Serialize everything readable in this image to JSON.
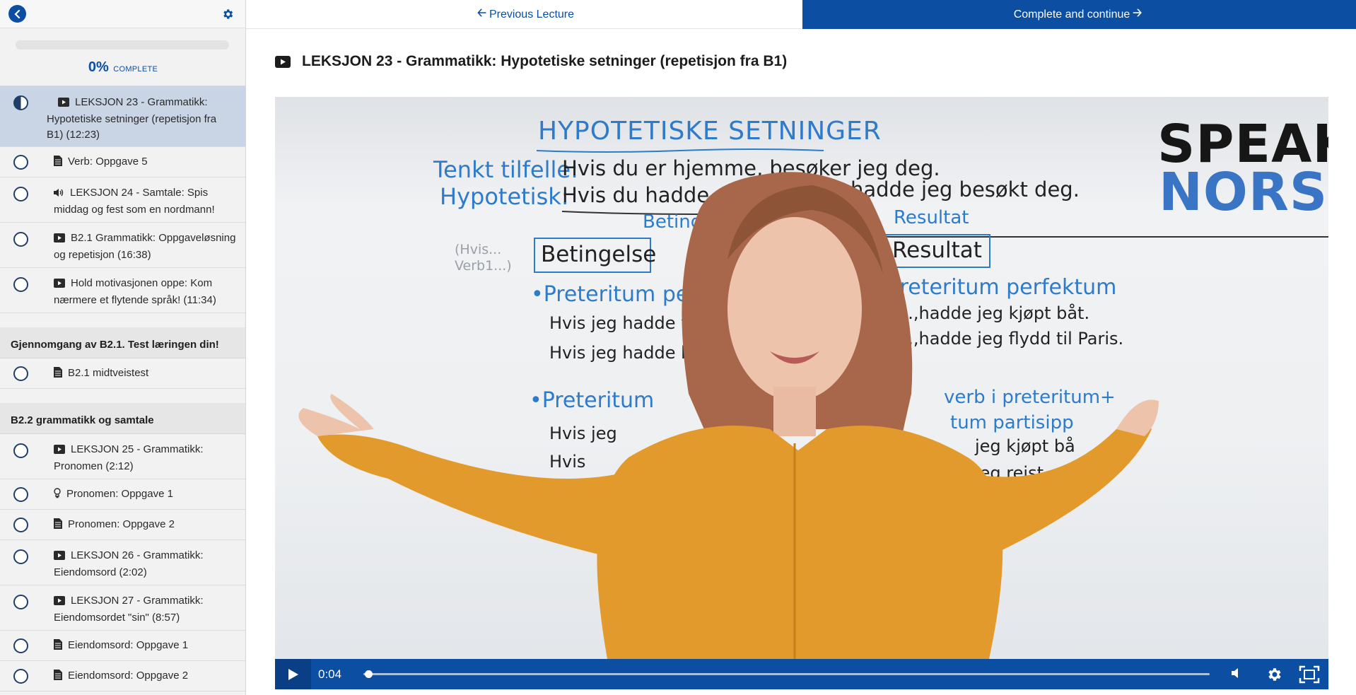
{
  "sidebar": {
    "progress": {
      "percent_text": "0%",
      "complete_label": "COMPLETE",
      "fraction": 0
    },
    "lectures_top": [
      {
        "icon": "video-icon",
        "title": "LEKSJON 23 - Grammatikk: Hypotetiske setninger (repetisjon fra B1) (12:23)",
        "active": true
      },
      {
        "icon": "document-icon",
        "title": "Verb: Oppgave 5",
        "active": false
      },
      {
        "icon": "audio-icon",
        "title": "LEKSJON 24 - Samtale: Spis middag og fest som en nordmann!",
        "active": false
      },
      {
        "icon": "video-icon",
        "title": "B2.1 Grammatikk: Oppgaveløsning og repetisjon (16:38)",
        "active": false
      },
      {
        "icon": "video-icon",
        "title": "Hold motivasjonen oppe: Kom nærmere et flytende språk! (11:34)",
        "active": false
      }
    ],
    "section1": {
      "title": "Gjennomgang av B2.1. Test læringen din!",
      "lectures": [
        {
          "icon": "document-icon",
          "title": "B2.1 midtveistest"
        }
      ]
    },
    "section2": {
      "title": "B2.2 grammatikk og samtale",
      "lectures": [
        {
          "icon": "video-icon",
          "title": "LEKSJON 25 - Grammatikk: Pronomen (2:12)"
        },
        {
          "icon": "lightbulb-icon",
          "title": "Pronomen: Oppgave 1"
        },
        {
          "icon": "document-icon",
          "title": "Pronomen: Oppgave 2"
        },
        {
          "icon": "video-icon",
          "title": "LEKSJON 26 - Grammatikk: Eiendomsord (2:02)"
        },
        {
          "icon": "video-icon",
          "title": "LEKSJON 27 - Grammatikk: Eiendomsordet \"sin\" (8:57)"
        },
        {
          "icon": "document-icon",
          "title": "Eiendomsord: Oppgave 1"
        },
        {
          "icon": "document-icon",
          "title": "Eiendomsord: Oppgave 2"
        }
      ]
    }
  },
  "topbar": {
    "previous_label": "Previous Lecture",
    "complete_label": "Complete and continue"
  },
  "lecture": {
    "title": "LEKSJON 23 - Grammatikk: Hypotetiske setninger (repetisjon fra B1)"
  },
  "video": {
    "whiteboard": {
      "heading": "HYPOTETISKE SETNINGER",
      "label_tenkt": "Tenkt tilfelle:",
      "line_tenkt": "Hvis du er hjemme, besøker jeg deg.",
      "label_hypo": "Hypotetisk:",
      "line_hypo_a": "Hvis du hadde va",
      "line_hypo_b": "hadde jeg besøkt deg.",
      "betinge": "Betinge",
      "resultat_small": "Resultat",
      "hvis_verb": "(Hvis...\nVerb1...)",
      "box_betingelse": "Betingelse",
      "box_resultat": "Resultat",
      "pret_perf_left": "•Preteritum perfekt",
      "pret_perf_right": "Preteritum perfektum",
      "left_l1": "Hvis jeg hadde vunn",
      "left_l2": "Hvis jeg hadde ku",
      "right_l1": "...,hadde jeg kjøpt båt.",
      "right_l2": "...,hadde jeg flydd til Paris.",
      "pret_left": "•Preteritum",
      "pret_right_a": "verb i preteritum+",
      "pret_right_b": "tum partisipp",
      "left_l3": "Hvis jeg",
      "left_l4": "Hvis",
      "right_l3": "jeg kjøpt bå",
      "right_l4": "jeg reist"
    },
    "brand_line1": "SPEAK",
    "brand_line2": "NORSK",
    "current_time": "0:04",
    "played_fraction": 0.005
  }
}
